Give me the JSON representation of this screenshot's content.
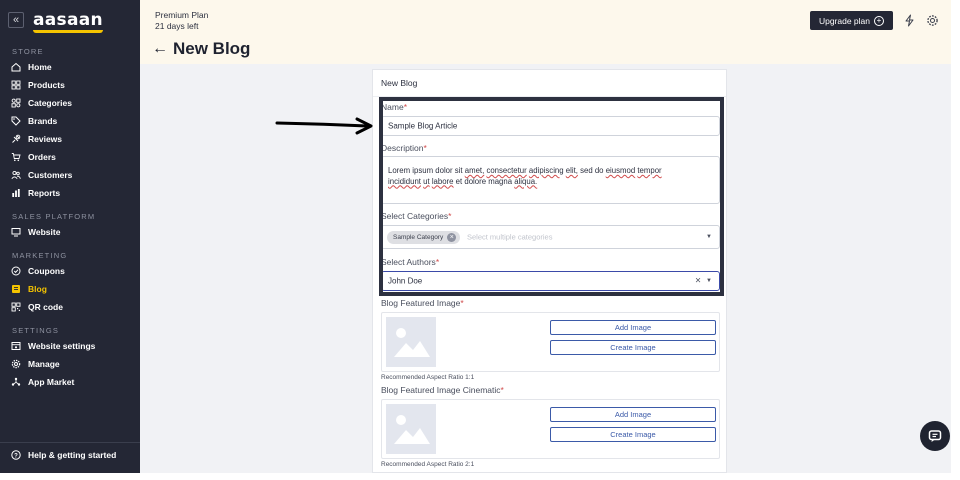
{
  "sidebar": {
    "collapse_icon": "«",
    "logo": "aasaan",
    "sections": [
      {
        "title": "STORE",
        "items": [
          {
            "label": "Home",
            "icon": "home-icon"
          },
          {
            "label": "Products",
            "icon": "grid-icon"
          },
          {
            "label": "Categories",
            "icon": "categories-icon"
          },
          {
            "label": "Brands",
            "icon": "tag-icon"
          },
          {
            "label": "Reviews",
            "icon": "reviews-icon"
          },
          {
            "label": "Orders",
            "icon": "cart-icon"
          },
          {
            "label": "Customers",
            "icon": "users-icon"
          },
          {
            "label": "Reports",
            "icon": "chart-icon"
          }
        ]
      },
      {
        "title": "SALES PLATFORM",
        "items": [
          {
            "label": "Website",
            "icon": "monitor-icon"
          }
        ]
      },
      {
        "title": "MARKETING",
        "items": [
          {
            "label": "Coupons",
            "icon": "coupon-icon"
          },
          {
            "label": "Blog",
            "icon": "blog-icon",
            "active": true
          },
          {
            "label": "QR code",
            "icon": "qr-icon"
          }
        ]
      },
      {
        "title": "SETTINGS",
        "items": [
          {
            "label": "Website settings",
            "icon": "website-settings-icon"
          },
          {
            "label": "Manage",
            "icon": "gear-icon"
          },
          {
            "label": "App Market",
            "icon": "app-market-icon"
          }
        ]
      }
    ],
    "help_label": "Help & getting started",
    "active_color": "#f5c400"
  },
  "header": {
    "plan_name": "Premium Plan",
    "plan_days": "21 days left",
    "page_title": "New Blog",
    "upgrade_label": "Upgrade plan"
  },
  "form": {
    "card_title": "New Blog",
    "name": {
      "label": "Name",
      "value": "Sample Blog Article"
    },
    "description": {
      "label": "Description",
      "value": "Lorem ipsum dolor sit amet, consectetur adipiscing elit, sed do eiusmod tempor incididunt ut labore et dolore magna aliqua."
    },
    "categories": {
      "label": "Select Categories",
      "chip": "Sample Category",
      "placeholder": "Select multiple categories"
    },
    "authors": {
      "label": "Select Authors",
      "value": "John Doe"
    },
    "featured_image": {
      "label": "Blog Featured Image",
      "add": "Add Image",
      "create": "Create Image",
      "hint": "Recommended Aspect Ratio 1:1"
    },
    "featured_cinematic": {
      "label": "Blog Featured Image Cinematic",
      "add": "Add Image",
      "create": "Create Image",
      "hint": "Recommended Aspect Ratio 2:1"
    },
    "required_mark": "*"
  }
}
